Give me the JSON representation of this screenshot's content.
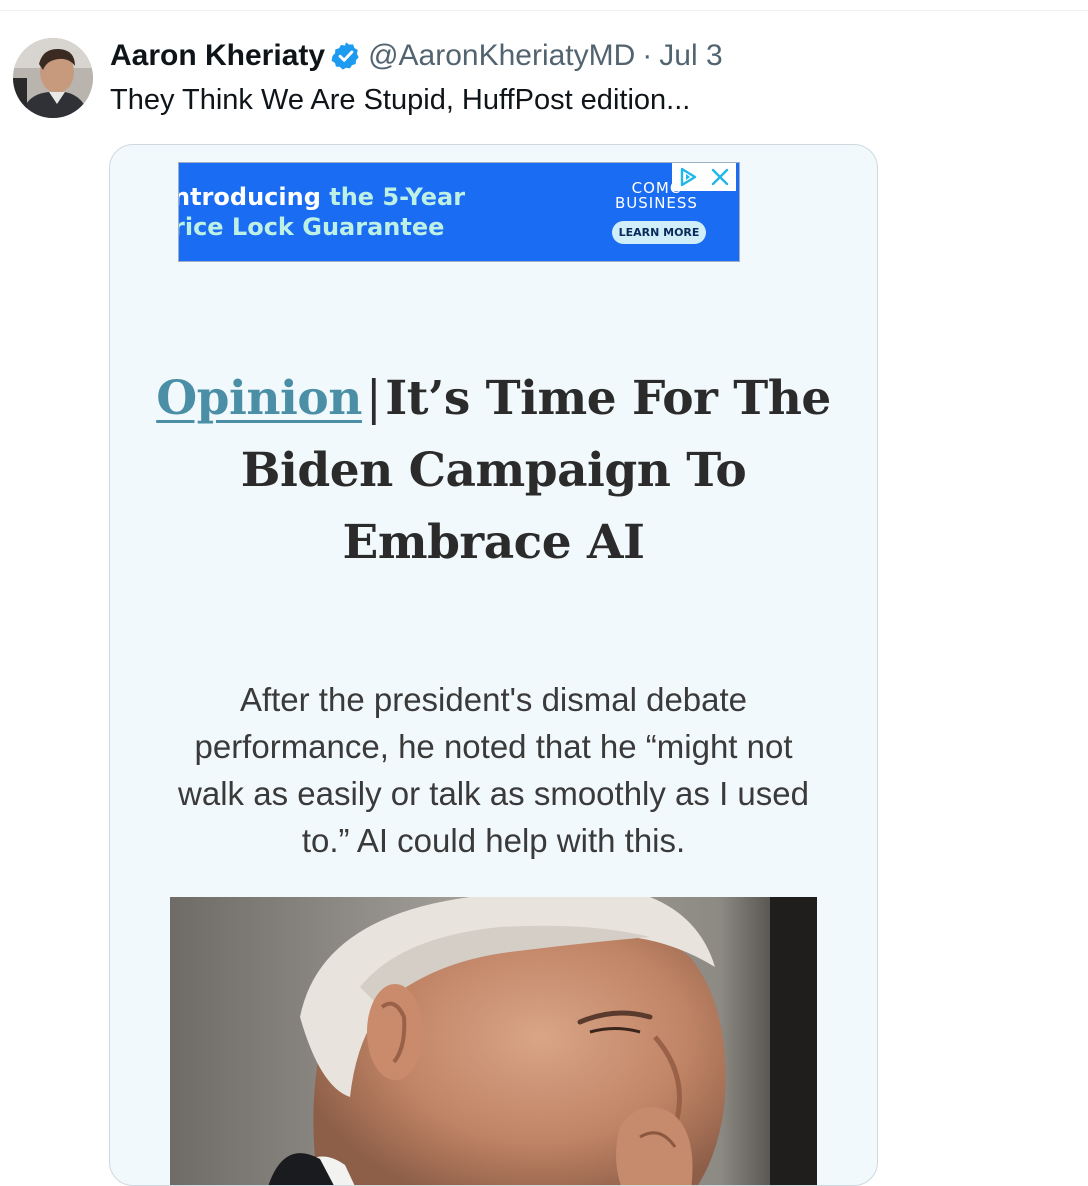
{
  "tweet": {
    "author_name": "Aaron Kheriaty",
    "handle": "@AaronKheriatyMD",
    "separator": "·",
    "date": "Jul 3",
    "text": "They Think We Are Stupid, HuffPost edition...",
    "verified_icon": "verified-badge-icon",
    "verified_color": "#1d9bf0"
  },
  "card": {
    "ad": {
      "line1_white": "ntroducing ",
      "line1_accent": "the 5-Year",
      "line2_accent": "rice Lock Guarantee",
      "brand_line1": "COMC",
      "brand_line2": "BUSINESS",
      "cta": "LEARN MORE",
      "adchoices_icon": "adchoices-play-icon",
      "close_icon": "close-icon",
      "background": "#1a6cf2"
    },
    "headline": {
      "section": "Opinion",
      "separator": "|",
      "title": "It’s Time For The Biden Campaign To Embrace AI"
    },
    "subhead": "After the president's dismal debate performance, he noted that he “might not walk as easily or talk as smoothly as I used to.” AI could help with this.",
    "image_icon": "article-photo"
  }
}
